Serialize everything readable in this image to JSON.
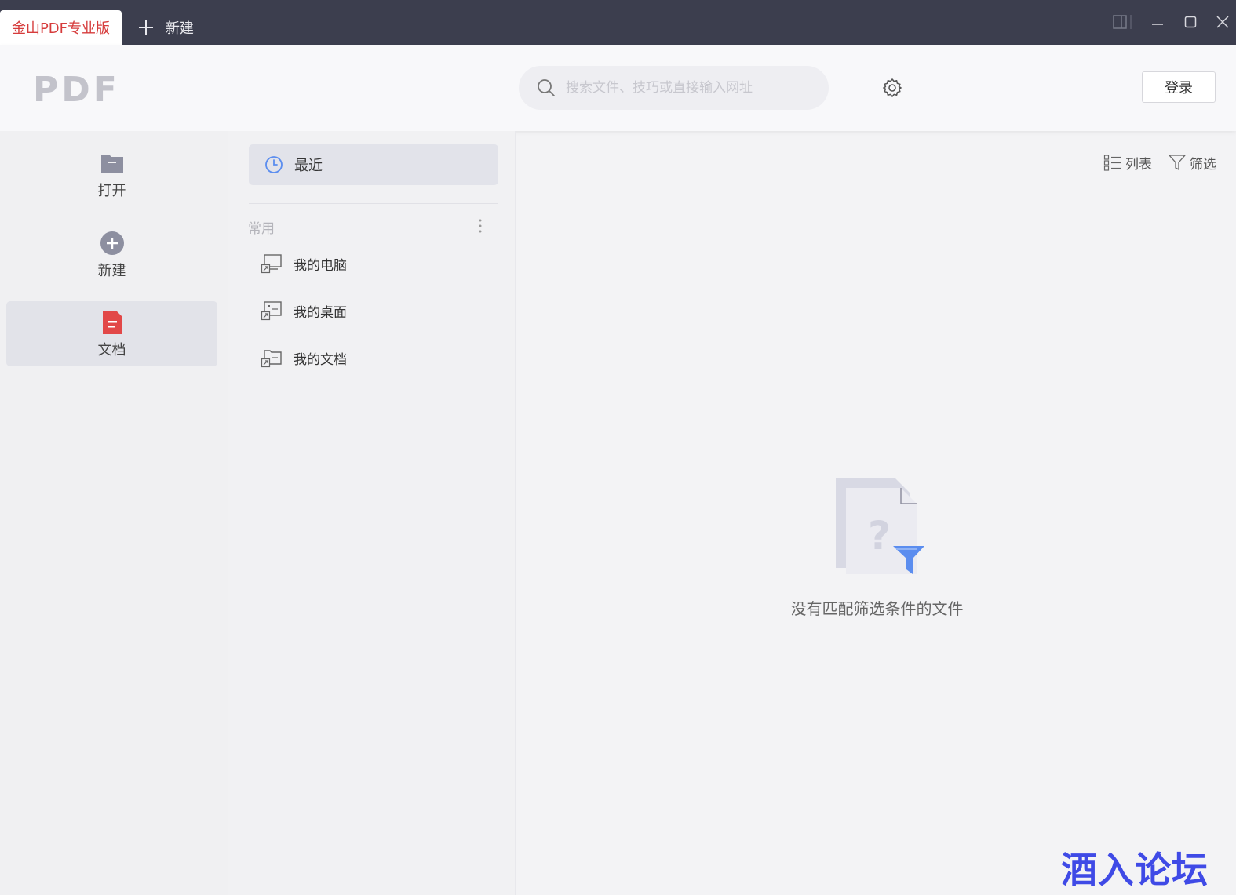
{
  "titlebar": {
    "active_tab": "金山PDF专业版",
    "new_tab": "新建"
  },
  "header": {
    "logo_text": "PDF",
    "search_placeholder": "搜索文件、技巧或直接输入网址",
    "login_label": "登录"
  },
  "left_nav": {
    "items": [
      {
        "label": "打开",
        "icon": "folder-icon"
      },
      {
        "label": "新建",
        "icon": "plus-circle-icon"
      },
      {
        "label": "文档",
        "icon": "document-icon"
      }
    ],
    "active": "文档"
  },
  "mid_panel": {
    "recent_label": "最近",
    "section_label": "常用",
    "locations": [
      {
        "label": "我的电脑",
        "icon": "computer-shortcut-icon"
      },
      {
        "label": "我的桌面",
        "icon": "desktop-shortcut-icon"
      },
      {
        "label": "我的文档",
        "icon": "documents-shortcut-icon"
      }
    ]
  },
  "content": {
    "view_label": "列表",
    "filter_label": "筛选",
    "empty_message": "没有匹配筛选条件的文件"
  },
  "watermark": "酒入论坛",
  "colors": {
    "titlebar_bg": "#3c3e4e",
    "accent_red": "#d63c3c",
    "accent_blue": "#5b8def",
    "watermark": "#3f4ae6"
  }
}
